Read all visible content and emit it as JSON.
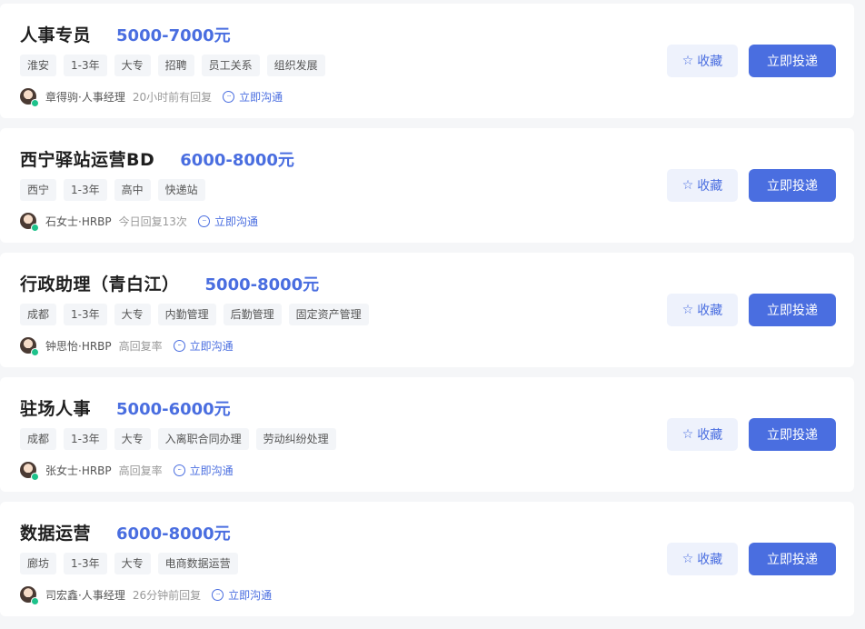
{
  "jobs": [
    {
      "title": "人事专员",
      "salary": "5000-7000元",
      "tags": [
        "淮安",
        "1-3年",
        "大专",
        "招聘",
        "员工关系",
        "组织发展"
      ],
      "recruiter": "章得驹·人事经理",
      "reply_status": "20小时前有回复",
      "chat_label": "立即沟通",
      "fav_label": "收藏",
      "apply_label": "立即投递"
    },
    {
      "title": "西宁驿站运营BD",
      "salary": "6000-8000元",
      "tags": [
        "西宁",
        "1-3年",
        "高中",
        "快递站"
      ],
      "recruiter": "石女士·HRBP",
      "reply_status": "今日回复13次",
      "chat_label": "立即沟通",
      "fav_label": "收藏",
      "apply_label": "立即投递"
    },
    {
      "title": "行政助理（青白江）",
      "salary": "5000-8000元",
      "tags": [
        "成都",
        "1-3年",
        "大专",
        "内勤管理",
        "后勤管理",
        "固定资产管理"
      ],
      "recruiter": "钟思怡·HRBP",
      "reply_status": "高回复率",
      "chat_label": "立即沟通",
      "fav_label": "收藏",
      "apply_label": "立即投递"
    },
    {
      "title": "驻场人事",
      "salary": "5000-6000元",
      "tags": [
        "成都",
        "1-3年",
        "大专",
        "入离职合同办理",
        "劳动纠纷处理"
      ],
      "recruiter": "张女士·HRBP",
      "reply_status": "高回复率",
      "chat_label": "立即沟通",
      "fav_label": "收藏",
      "apply_label": "立即投递"
    },
    {
      "title": "数据运营",
      "salary": "6000-8000元",
      "tags": [
        "廊坊",
        "1-3年",
        "大专",
        "电商数据运营"
      ],
      "recruiter": "司宏鑫·人事经理",
      "reply_status": "26分钟前回复",
      "chat_label": "立即沟通",
      "fav_label": "收藏",
      "apply_label": "立即投递"
    }
  ],
  "icons": {
    "star": "star-outline-icon",
    "chat": "chat-bubble-icon",
    "avatar": "recruiter-avatar",
    "online": "online-status-dot"
  },
  "colors": {
    "accent": "#4a6ee0",
    "online": "#1ec28b",
    "fav_bg": "#eef2fc",
    "tag_bg": "#f3f5f8"
  }
}
